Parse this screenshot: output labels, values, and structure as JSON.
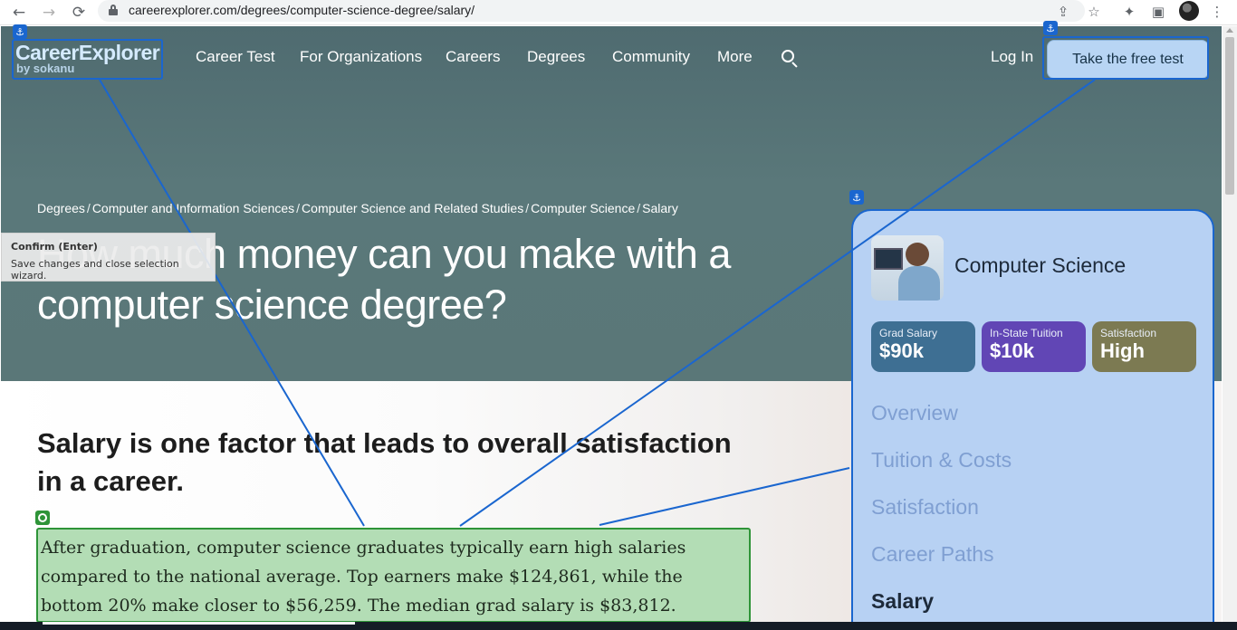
{
  "browser": {
    "url": "careerexplorer.com/degrees/computer-science-degree/salary/",
    "back_icon": "←",
    "forward_icon": "→",
    "reload_icon": "⟳",
    "share_icon": "⇪",
    "star_icon": "☆",
    "extensions_icon": "✦",
    "sidepanel_icon": "▣",
    "menu_icon": "⋮"
  },
  "header": {
    "logo_main": "CareerExplorer",
    "logo_sub": "by sokanu",
    "nav": [
      "Career Test",
      "For Organizations",
      "Careers",
      "Degrees",
      "Community",
      "More"
    ],
    "login": "Log In",
    "cta": "Take the free test"
  },
  "hero": {
    "breadcrumb": [
      "Degrees",
      "Computer and Information Sciences",
      "Computer Science and Related Studies",
      "Computer Science",
      "Salary"
    ],
    "title": "How much money can you make with a computer science degree?"
  },
  "content": {
    "heading": "Salary is one factor that leads to overall satisfaction in a career.",
    "paragraph": "After graduation, computer science graduates typically earn high salaries compared to the national average. Top earners make $124,861, while the bottom 20% make closer to $56,259. The median grad salary is $83,812."
  },
  "sidebar": {
    "degree_name": "Computer Science",
    "stats": [
      {
        "label": "Grad Salary",
        "value": "$90k",
        "color": "#3e6f93"
      },
      {
        "label": "In-State Tuition",
        "value": "$10k",
        "color": "#6146b5"
      },
      {
        "label": "Satisfaction",
        "value": "High",
        "color": "#7c7a52"
      }
    ],
    "links": [
      "Overview",
      "Tuition & Costs",
      "Satisfaction",
      "Career Paths",
      "Salary"
    ],
    "active_link": "Salary"
  },
  "tooltip": {
    "title": "Confirm (Enter)",
    "body": "Save changes and close selection wizard."
  },
  "annotation": {
    "anchor_icon": "⚓"
  },
  "colors": {
    "hero_bg": "#577577",
    "accent_blue": "#1a66cf",
    "highlight_green": "#2e9438",
    "sidebar_bg": "#b7d1f3"
  }
}
